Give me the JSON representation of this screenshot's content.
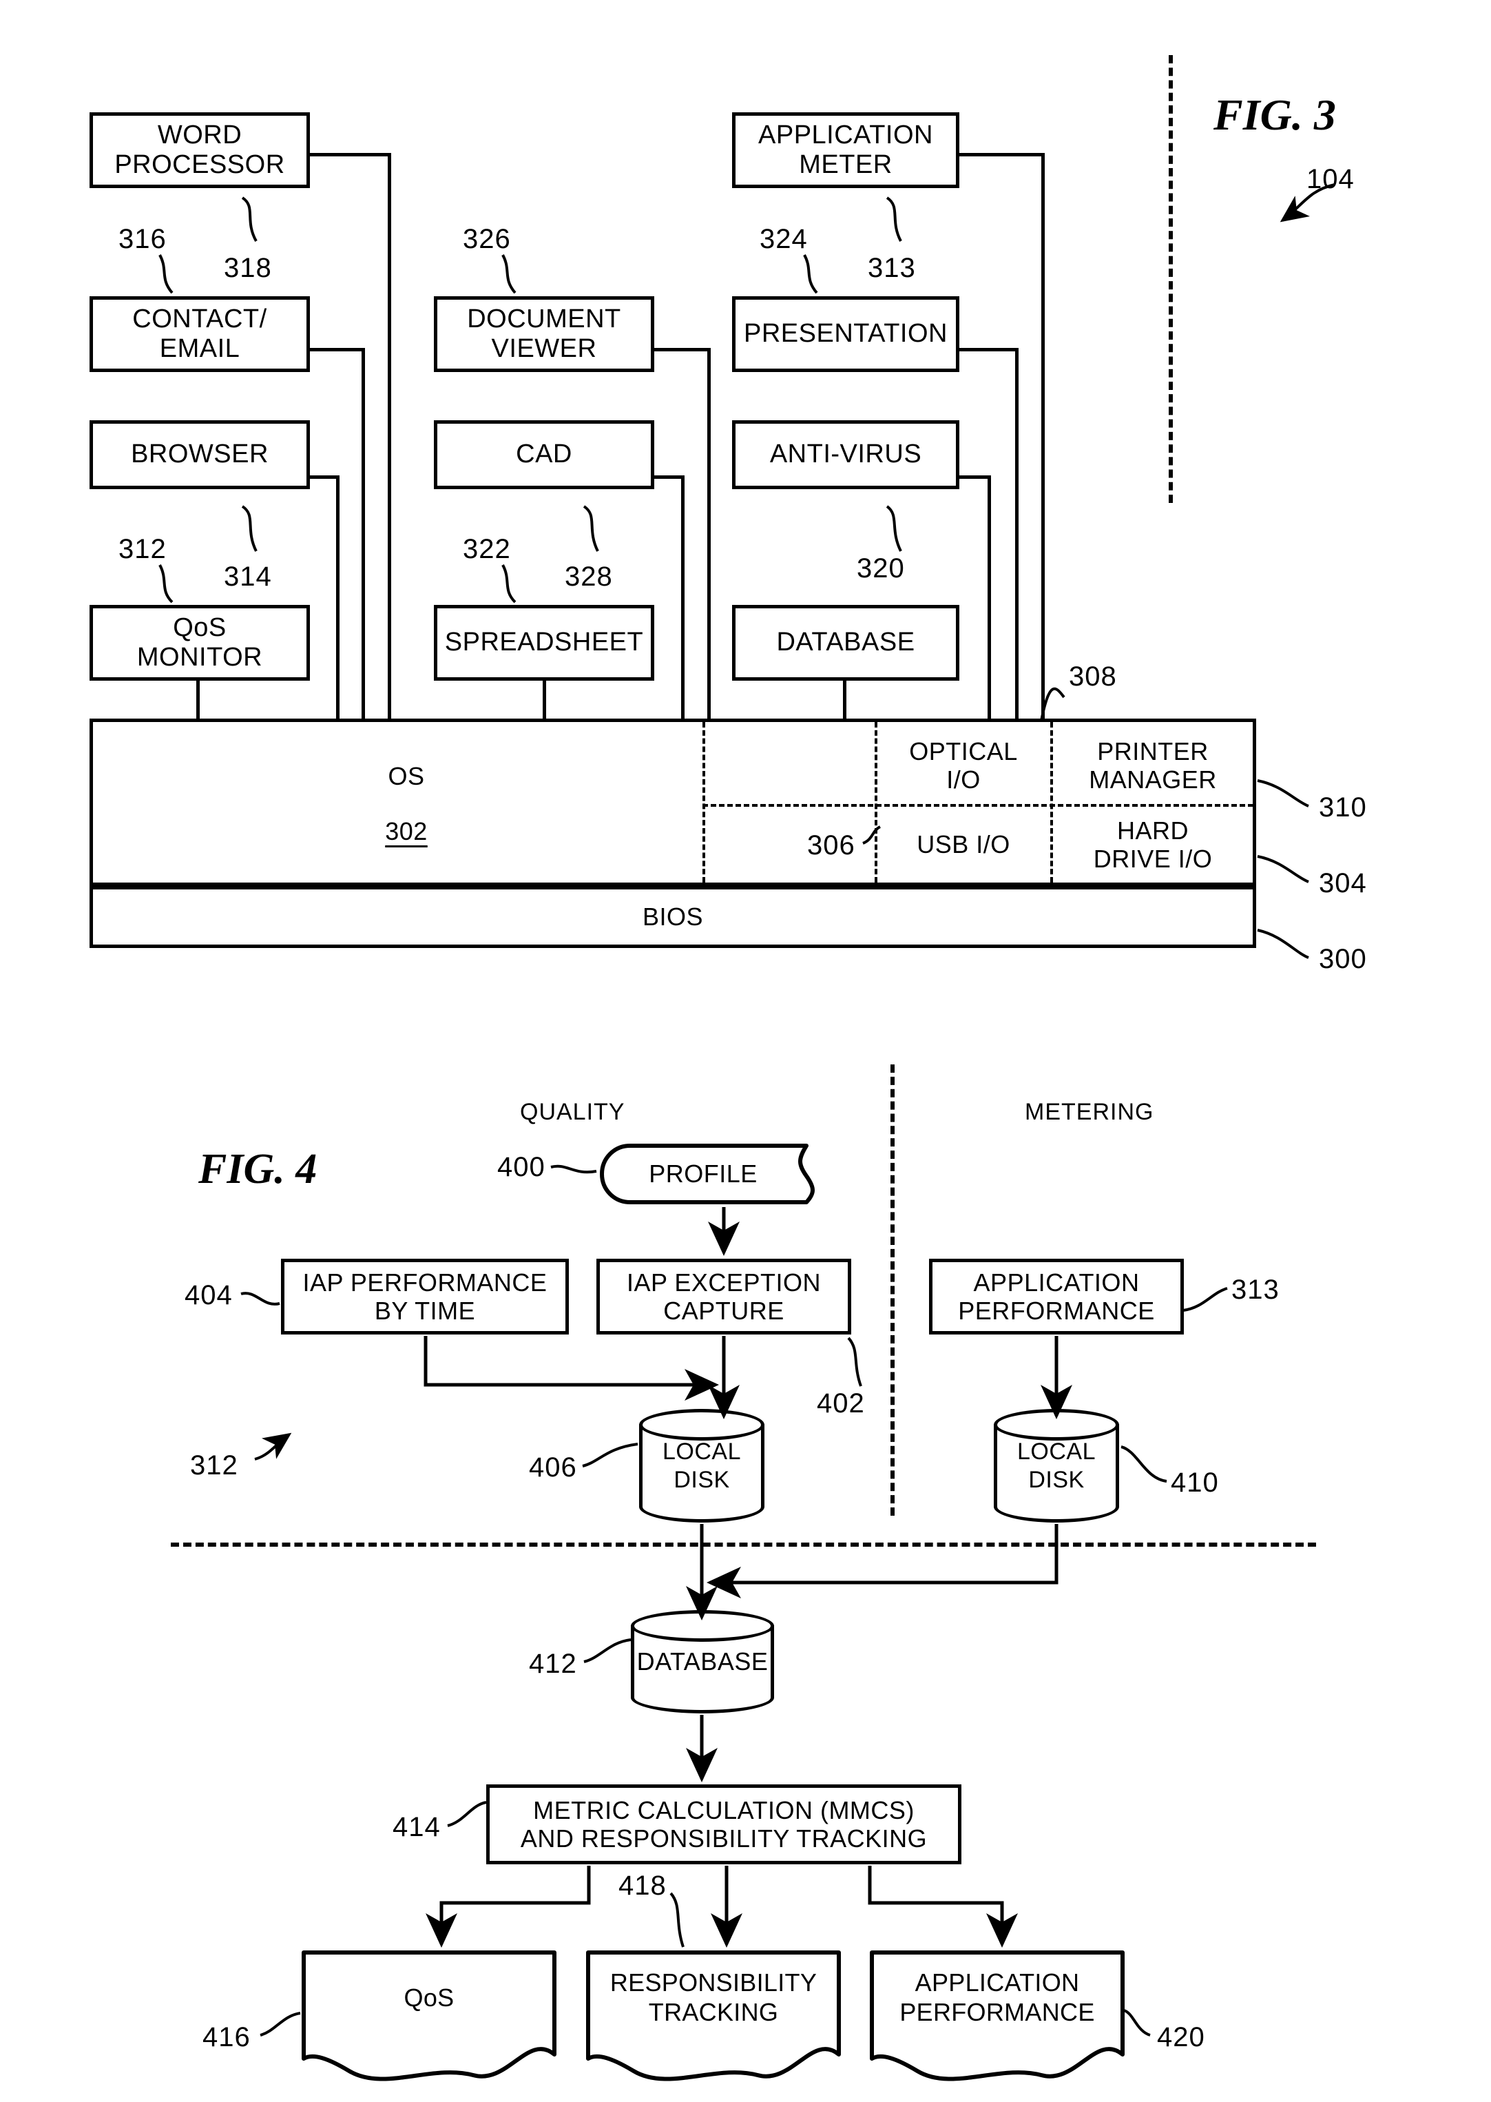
{
  "figure3": {
    "title": "FIG. 3",
    "ref_overall": "104",
    "apps": {
      "word_processor": "WORD PROCESSOR",
      "contact_email": "CONTACT/ EMAIL",
      "browser": "BROWSER",
      "qos_monitor": "QoS MONITOR",
      "document_viewer": "DOCUMENT VIEWER",
      "cad": "CAD",
      "spreadsheet": "SPREADSHEET",
      "application_meter": "APPLICATION METER",
      "presentation": "PRESENTATION",
      "anti_virus": "ANTI-VIRUS",
      "database": "DATABASE"
    },
    "app_lines": {
      "word_processor": [
        "WORD",
        "PROCESSOR"
      ],
      "contact_email": [
        "CONTACT/",
        "EMAIL"
      ],
      "browser": [
        "BROWSER"
      ],
      "qos_monitor": [
        "QoS",
        "MONITOR"
      ],
      "document_viewer": [
        "DOCUMENT",
        "VIEWER"
      ],
      "cad": [
        "CAD"
      ],
      "spreadsheet": [
        "SPREADSHEET"
      ],
      "application_meter": [
        "APPLICATION",
        "METER"
      ],
      "presentation": [
        "PRESENTATION"
      ],
      "anti_virus": [
        "ANTI-VIRUS"
      ],
      "database": [
        "DATABASE"
      ]
    },
    "platform": {
      "os_label": "OS",
      "os_ref": "302",
      "optical_io": [
        "OPTICAL",
        "I/O"
      ],
      "usb_io": [
        "USB I/O"
      ],
      "printer_manager": [
        "PRINTER",
        "MANAGER"
      ],
      "hard_drive_io": [
        "HARD",
        "DRIVE I/O"
      ],
      "bios_label": "BIOS"
    },
    "refs": {
      "r316": "316",
      "r318": "318",
      "r312": "312",
      "r314": "314",
      "r326": "326",
      "r322": "322",
      "r328": "328",
      "r324": "324",
      "r313": "313",
      "r320": "320",
      "r308": "308",
      "r306": "306",
      "r310": "310",
      "r304": "304",
      "r300": "300"
    }
  },
  "figure4": {
    "title": "FIG. 4",
    "columns": {
      "quality": "QUALITY",
      "metering": "METERING"
    },
    "nodes": {
      "profile": "PROFILE",
      "iap_performance_by_time": [
        "IAP PERFORMANCE",
        "BY TIME"
      ],
      "iap_exception_capture": [
        "IAP EXCEPTION",
        "CAPTURE"
      ],
      "application_performance": [
        "APPLICATION",
        "PERFORMANCE"
      ],
      "local_disk_quality": [
        "LOCAL",
        "DISK"
      ],
      "local_disk_metering": [
        "LOCAL",
        "DISK"
      ],
      "database": [
        "DATABASE"
      ],
      "metric_calculation": [
        "METRIC CALCULATION (MMCS)",
        "AND RESPONSIBILITY TRACKING"
      ],
      "qos_out": [
        "QoS"
      ],
      "responsibility_tracking_out": [
        "RESPONSIBILITY",
        "TRACKING"
      ],
      "application_performance_out": [
        "APPLICATION",
        "PERFORMANCE"
      ]
    },
    "refs": {
      "r400": "400",
      "r404": "404",
      "r402": "402",
      "r406": "406",
      "r410": "410",
      "r412": "412",
      "r414": "414",
      "r416": "416",
      "r418": "418",
      "r420": "420",
      "r313": "313",
      "r312": "312"
    }
  },
  "colors": {
    "ink": "#000000",
    "paper": "#ffffff"
  }
}
